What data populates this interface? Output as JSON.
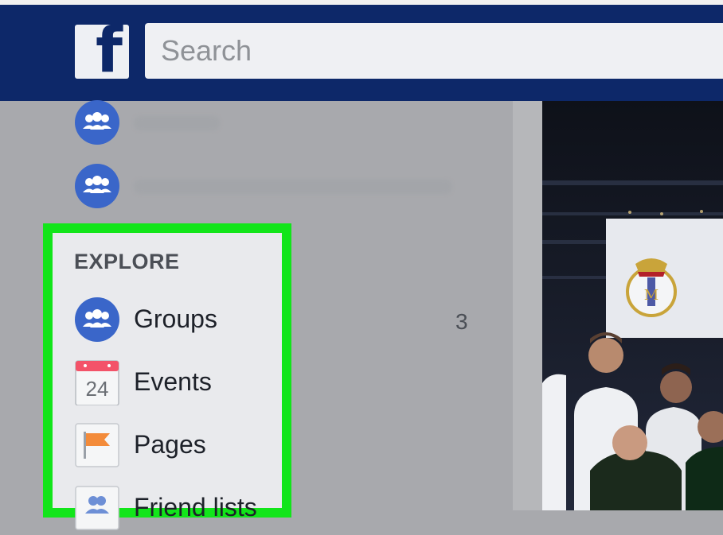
{
  "header": {
    "logo_letter": "f",
    "search_placeholder": "Search"
  },
  "colors": {
    "header_bg": "#0d2869",
    "highlight_border": "#12e51a",
    "group_icon": "#3a66c9",
    "events_red": "#f35369",
    "pages_orange": "#f38b3a"
  },
  "sidebar": {
    "explore_title": "EXPLORE",
    "items": [
      {
        "label": "Groups",
        "icon": "groups-icon",
        "count": "3"
      },
      {
        "label": "Events",
        "icon": "calendar-icon",
        "date": "24"
      },
      {
        "label": "Pages",
        "icon": "flag-icon"
      },
      {
        "label": "Friend lists",
        "icon": "friend-list-icon"
      }
    ]
  }
}
